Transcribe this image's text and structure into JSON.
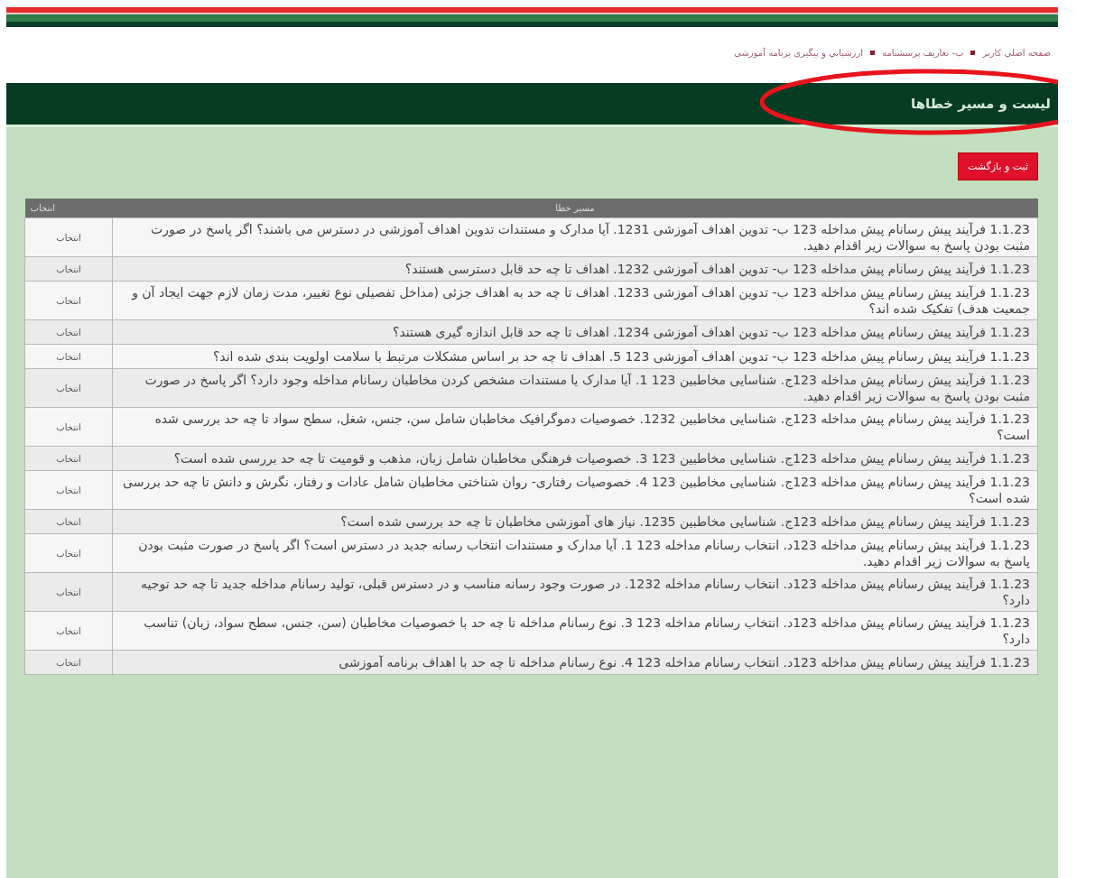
{
  "breadcrumb": [
    "صفحه اصلی کاربر",
    "ب- تعاریف پرسشنامه",
    "ارزشیابی و پیگیری برنامه آموزشی"
  ],
  "page_title": "لیست و مسیر خطاها",
  "action_button": "ثبت و بازگشت",
  "table": {
    "columns": [
      "مسیر خطا",
      "انتخاب"
    ],
    "rows": [
      {
        "text": "1.1.23 فرآیند پیش رسانام پیش مداخله 123 ب- تدوین اهداف آموزشی 1231. آیا مدارک و مستندات تدوین اهداف آموزشی در دسترس می باشند؟ اگر پاسخ در صورت مثبت بودن پاسخ به سوالات زیر اقدام دهید.",
        "action": "انتخاب"
      },
      {
        "text": "1.1.23 فرآیند پیش رسانام پیش مداخله 123 ب- تدوین اهداف آموزشی 1232. اهداف تا چه حد قابل دسترسی هستند؟",
        "action": "انتخاب"
      },
      {
        "text": "1.1.23 فرآیند پیش رسانام پیش مداخله 123 ب- تدوین اهداف آموزشی 1233. اهداف تا چه حد به اهداف جزئی (مداخل تفصیلی نوع تغییر، مدت زمان لازم جهت ایجاد آن و جمعیت هدف) تفکیک شده اند؟",
        "action": "انتخاب"
      },
      {
        "text": "1.1.23 فرآیند پیش رسانام پیش مداخله 123 ب- تدوین اهداف آموزشی 1234. اهداف تا چه حد قابل اندازه گیری هستند؟",
        "action": "انتخاب"
      },
      {
        "text": "1.1.23 فرآیند پیش رسانام پیش مداخله 123 ب- تدوین اهداف آموزشی 123 5. اهداف تا چه حد بر اساس مشکلات مرتبط با سلامت اولویت بندی شده اند؟",
        "action": "انتخاب"
      },
      {
        "text": "1.1.23 فرآیند پیش رسانام پیش مداخله 123ج. شناسایی مخاطبین 123 1. آیا مدارک یا مستندات مشخص کردن مخاطبان رسانام مداخله وجود دارد؟ اگر پاسخ در صورت مثبت بودن پاسخ به سوالات زیر اقدام دهید.",
        "action": "انتخاب"
      },
      {
        "text": "1.1.23 فرآیند پیش رسانام پیش مداخله 123ج. شناسایی مخاطبین 1232. خصوصیات دموگرافیک مخاطبان شامل سن، جنس، شغل، سطح سواد تا چه حد بررسی شده است؟",
        "action": "انتخاب"
      },
      {
        "text": "1.1.23 فرآیند پیش رسانام پیش مداخله 123ج. شناسایی مخاطبین 123 3. خصوصیات فرهنگی مخاطبان شامل زبان، مذهب و قومیت تا چه حد بررسی شده است؟",
        "action": "انتخاب"
      },
      {
        "text": "1.1.23 فرآیند پیش رسانام پیش مداخله 123ج. شناسایی مخاطبین 123 4. خصوصیات رفتاری- روان شناختی مخاطبان شامل عادات و رفتار، نگرش و دانش تا چه حد بررسی شده است؟",
        "action": "انتخاب"
      },
      {
        "text": "1.1.23 فرآیند پیش رسانام پیش مداخله 123ج. شناسایی مخاطبین 1235. نیاز های آموزشی مخاطبان تا چه حد بررسی شده است؟",
        "action": "انتخاب"
      },
      {
        "text": "1.1.23 فرآیند پیش رسانام پیش مداخله 123د. انتخاب رسانام مداخله 123 1. آیا مدارک و مستندات انتخاب رسانه جدید در دسترس است؟ اگر پاسخ در صورت مثبت بودن پاسخ به سوالات زیر اقدام دهید.",
        "action": "انتخاب"
      },
      {
        "text": "1.1.23 فرآیند پیش رسانام پیش مداخله 123د. انتخاب رسانام مداخله 1232. در صورت وجود رسانه مناسب و در دسترس قبلی، تولید رسانام مداخله جدید تا چه حد توجیه دارد؟",
        "action": "انتخاب"
      },
      {
        "text": "1.1.23 فرآیند پیش رسانام پیش مداخله 123د. انتخاب رسانام مداخله 123 3. نوع رسانام مداخله تا چه حد با خصوصیات مخاطبان (سن، جنس، سطح سواد، زبان) تناسب دارد؟",
        "action": "انتخاب"
      },
      {
        "text": "1.1.23 فرآیند پیش رسانام پیش مداخله 123د. انتخاب رسانام مداخله 123 4. نوع رسانام مداخله تا چه حد با اهداف برنامه آموزشی",
        "action": "انتخاب"
      }
    ]
  }
}
